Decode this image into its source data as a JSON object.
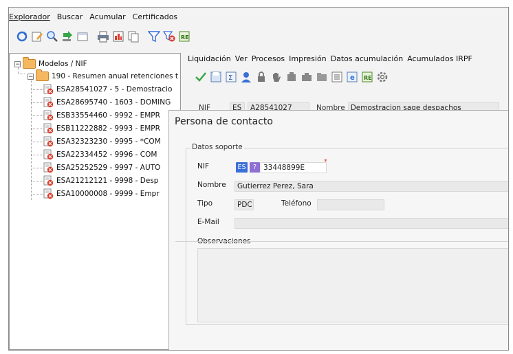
{
  "menubar": {
    "items": [
      {
        "label": "Explorador"
      },
      {
        "label": "Buscar"
      },
      {
        "label": "Acumular"
      },
      {
        "label": "Certificados"
      }
    ]
  },
  "tree": {
    "root": "Modelos / NIF",
    "group": "190 - Resumen anual retenciones t",
    "items": [
      "ESA28541027 - 5 - Demostracio",
      "ESA28695740 - 1603 - DOMING",
      "ESB33554460 - 9992 - EMPR",
      "ESB11222882 - 9993 - EMPR",
      "ESA32323230 - 9995 - *COM",
      "ESA22334452 - 9996 - COM",
      "ESA25252529 - 9997 - AUTO",
      "ESA21212121 - 9998 - Desp",
      "ESA10000008 - 9999 - Empr"
    ]
  },
  "submenu": {
    "items": [
      {
        "label": "Liquidación"
      },
      {
        "label": "Ver"
      },
      {
        "label": "Procesos"
      },
      {
        "label": "Impresión"
      },
      {
        "label": "Datos acumulación"
      },
      {
        "label": "Acumulados IRPF"
      }
    ]
  },
  "background_form": {
    "nif_label": "NIF",
    "country": "ES",
    "nif": "A28541027",
    "nombre_label": "Nombre",
    "nombre": "Demostracion sage despachos"
  },
  "dialog": {
    "title": "Persona de contacto",
    "group_title": "Datos soporte",
    "nif_label": "NIF",
    "nif_country": "ES",
    "nif_help": "?",
    "nif_value": "33448899E",
    "required_mark": "*",
    "nombre_label": "Nombre",
    "nombre_value": "Gutierrez Perez, Sara",
    "tipo_label": "Tipo",
    "tipo_value": "PDC",
    "telefono_label": "Teléfono",
    "telefono_value": "",
    "email_label": "E-Mail",
    "email_value": "",
    "observaciones_label": "Observaciones",
    "observaciones_value": ""
  },
  "colors": {
    "accent_blue": "#3a6fd8",
    "doc_red": "#d93a2b",
    "folder": "#f4b860"
  }
}
